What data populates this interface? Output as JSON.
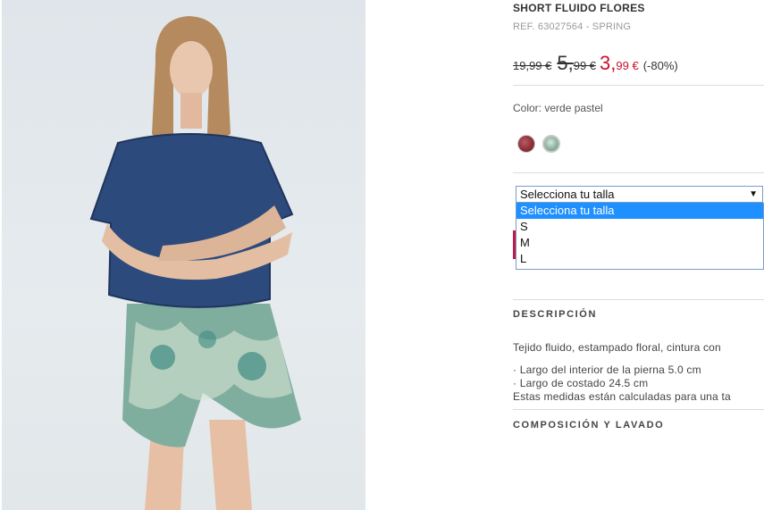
{
  "product": {
    "title": "SHORT FLUIDO FLORES",
    "ref": "REF. 63027564 - SPRING"
  },
  "price": {
    "original": "19,99 €",
    "previous_int": "5,",
    "previous_dec": "99 €",
    "sale_int": "3,",
    "sale_dec": "99 €",
    "discount": "(-80%)",
    "sale_color": "#c8102e"
  },
  "color": {
    "label": "Color: verde pastel",
    "swatches": [
      "burgundy-floral",
      "green-floral"
    ]
  },
  "size_select": {
    "current": "Selecciona tu talla",
    "options": [
      "Selecciona tu talla",
      "S",
      "M",
      "L"
    ],
    "highlight_color": "#1e90ff"
  },
  "description": {
    "heading": "DESCRIPCIÓN",
    "text": "Tejido fluido, estampado floral, cintura con",
    "line1": "· Largo del interior de la pierna 5.0 cm",
    "line2": "· Largo de costado 24.5 cm",
    "line3": "Estas medidas están calculadas para una ta"
  },
  "composition": {
    "heading": "COMPOSICIÓN Y LAVADO"
  }
}
